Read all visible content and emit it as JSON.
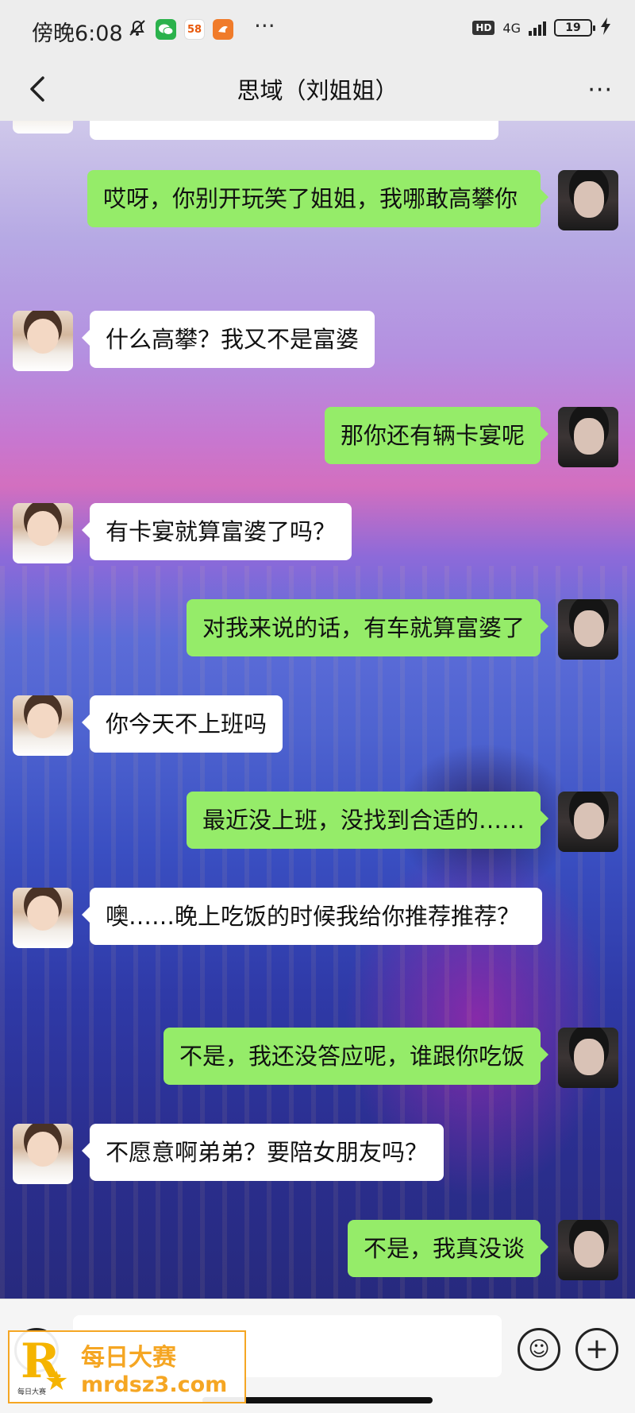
{
  "status_bar": {
    "time": "傍晚6:08",
    "app_badge_58": "58",
    "more_dots": "···",
    "hd": "HD",
    "network": "4G",
    "battery": "19"
  },
  "nav": {
    "title": "思域（刘姐姐）",
    "more": "···"
  },
  "messages": [
    {
      "side": "left",
      "text": ""
    },
    {
      "side": "right",
      "text": "哎呀，你别开玩笑了姐姐，我哪敢高攀你"
    },
    {
      "side": "left",
      "text": "什么高攀？我又不是富婆"
    },
    {
      "side": "right",
      "text": "那你还有辆卡宴呢"
    },
    {
      "side": "left",
      "text": "有卡宴就算富婆了吗？"
    },
    {
      "side": "right",
      "text": "对我来说的话，有车就算富婆了"
    },
    {
      "side": "left",
      "text": "你今天不上班吗"
    },
    {
      "side": "right",
      "text": "最近没上班，没找到合适的……"
    },
    {
      "side": "left",
      "text": "噢……晚上吃饭的时候我给你推荐推荐？"
    },
    {
      "side": "right",
      "text": "不是，我还没答应呢，谁跟你吃饭"
    },
    {
      "side": "left",
      "text": "不愿意啊弟弟？要陪女朋友吗？"
    },
    {
      "side": "right",
      "text": "不是，我真没谈"
    }
  ],
  "input_bar": {
    "placeholder": "",
    "emoji_glyph": "☺",
    "plus_glyph": "+"
  },
  "watermark": {
    "logo_letter": "R",
    "logo_star": "★",
    "logo_mini": "每日大赛",
    "title": "每日大赛",
    "url": "mrdsz3.com"
  },
  "colors": {
    "bubble_mine": "#95ec69",
    "bubble_theirs": "#ffffff",
    "watermark_accent": "#f5a623"
  }
}
